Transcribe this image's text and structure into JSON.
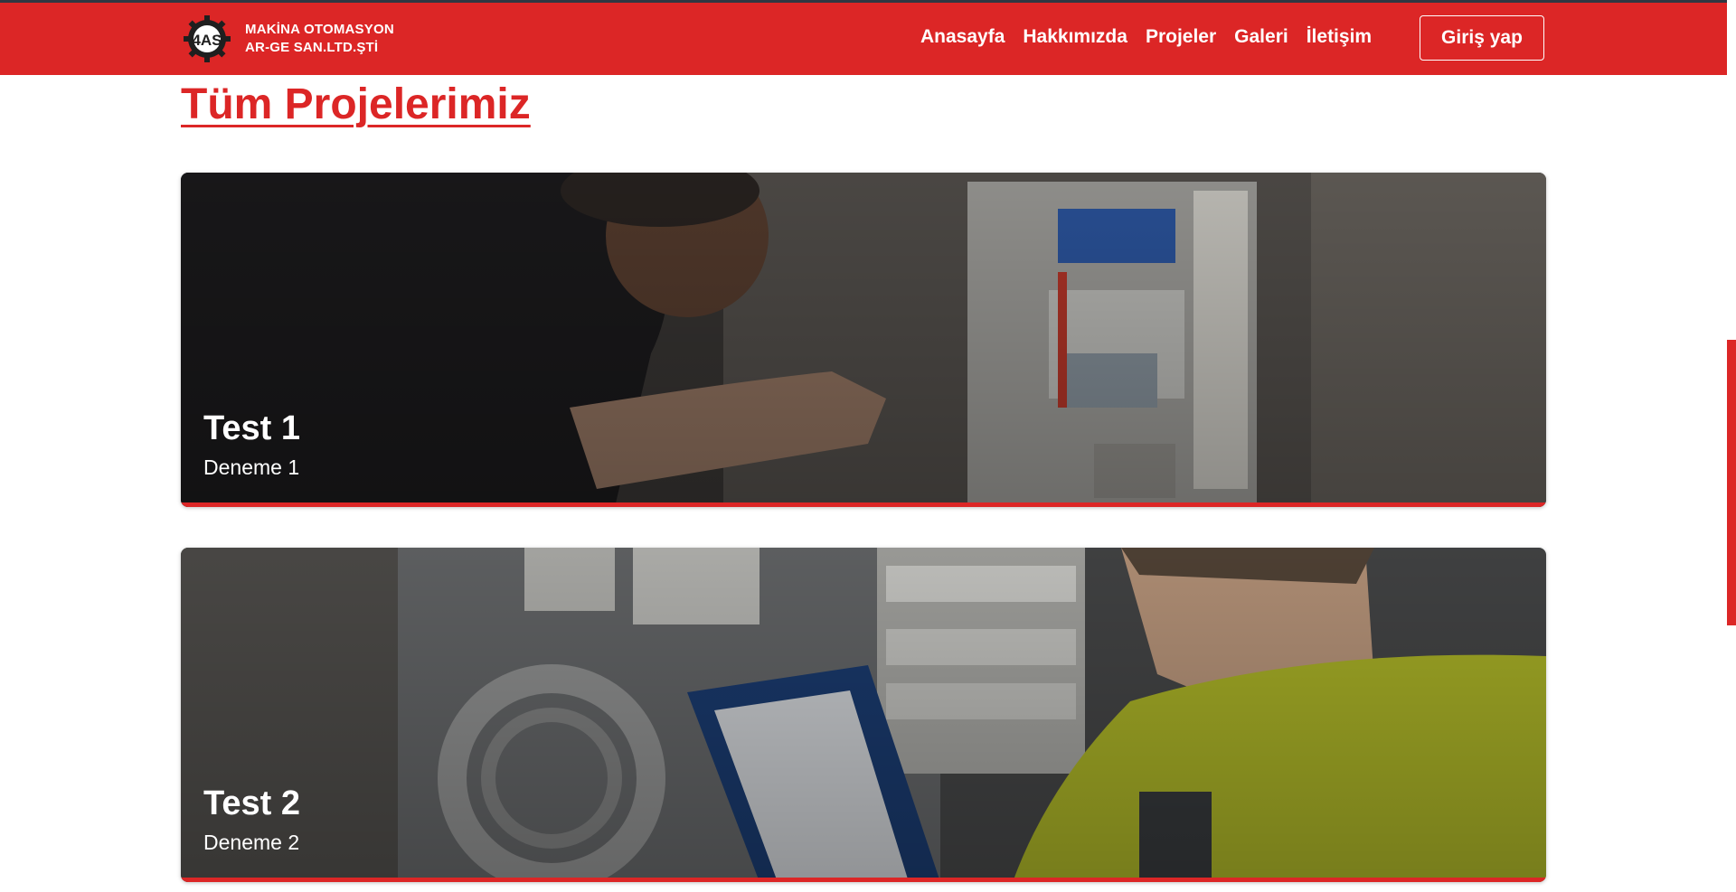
{
  "brand": {
    "line1": "MAKİNA OTOMASYON",
    "line2": "AR-GE SAN.LTD.ŞTİ",
    "logo_text": "4AS"
  },
  "nav": {
    "items": [
      {
        "label": "Anasayfa"
      },
      {
        "label": "Hakkımızda"
      },
      {
        "label": "Projeler"
      },
      {
        "label": "Galeri"
      },
      {
        "label": "İletişim"
      }
    ],
    "login_label": "Giriş yap"
  },
  "page": {
    "title": "Tüm Projelerimiz"
  },
  "projects": [
    {
      "title": "Test 1",
      "subtitle": "Deneme 1"
    },
    {
      "title": "Test 2",
      "subtitle": "Deneme 2"
    }
  ],
  "colors": {
    "brand_red": "#dc2626",
    "white": "#ffffff"
  },
  "icons": {
    "logo": "gear-logo-icon"
  }
}
